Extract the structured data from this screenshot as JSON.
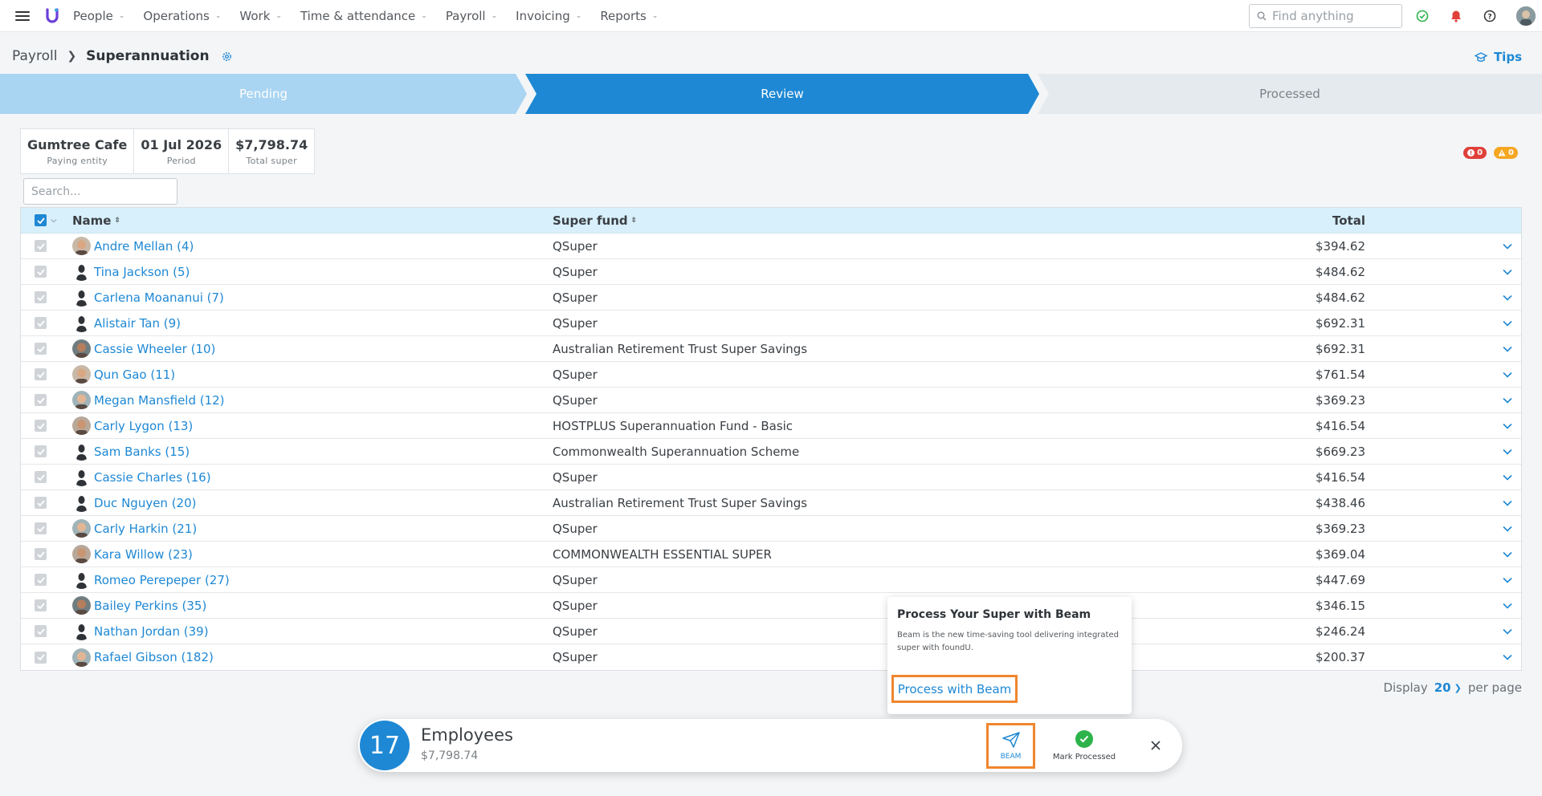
{
  "nav": {
    "items": [
      {
        "label": "People"
      },
      {
        "label": "Operations"
      },
      {
        "label": "Work"
      },
      {
        "label": "Time & attendance"
      },
      {
        "label": "Payroll"
      },
      {
        "label": "Invoicing"
      },
      {
        "label": "Reports"
      }
    ],
    "search_placeholder": "Find anything"
  },
  "breadcrumb": {
    "parent": "Payroll",
    "current": "Superannuation"
  },
  "tips_label": "Tips",
  "stepper": {
    "steps": [
      "Pending",
      "Review",
      "Processed"
    ],
    "active": "Review"
  },
  "summary": {
    "entity": "Gumtree Cafe",
    "entity_label": "Paying entity",
    "period": "01 Jul 2026",
    "period_label": "Period",
    "total": "$7,798.74",
    "total_label": "Total super"
  },
  "badges": {
    "errors": "0",
    "warnings": "0"
  },
  "table": {
    "search_placeholder": "Search...",
    "columns": {
      "name": "Name",
      "fund": "Super fund",
      "total": "Total"
    },
    "rows": [
      {
        "name": "Andre Mellan (4)",
        "fund": "QSuper",
        "total": "$394.62",
        "avatar": "photo"
      },
      {
        "name": "Tina Jackson (5)",
        "fund": "QSuper",
        "total": "$484.62",
        "avatar": "silhouette"
      },
      {
        "name": "Carlena Moananui (7)",
        "fund": "QSuper",
        "total": "$484.62",
        "avatar": "silhouette"
      },
      {
        "name": "Alistair Tan (9)",
        "fund": "QSuper",
        "total": "$692.31",
        "avatar": "silhouette"
      },
      {
        "name": "Cassie Wheeler (10)",
        "fund": "Australian Retirement Trust Super Savings",
        "total": "$692.31",
        "avatar": "photo"
      },
      {
        "name": "Qun Gao (11)",
        "fund": "QSuper",
        "total": "$761.54",
        "avatar": "photo"
      },
      {
        "name": "Megan Mansfield (12)",
        "fund": "QSuper",
        "total": "$369.23",
        "avatar": "photo"
      },
      {
        "name": "Carly Lygon (13)",
        "fund": "HOSTPLUS Superannuation Fund - Basic",
        "total": "$416.54",
        "avatar": "photo"
      },
      {
        "name": "Sam Banks (15)",
        "fund": "Commonwealth Superannuation Scheme",
        "total": "$669.23",
        "avatar": "silhouette"
      },
      {
        "name": "Cassie Charles (16)",
        "fund": "QSuper",
        "total": "$416.54",
        "avatar": "silhouette"
      },
      {
        "name": "Duc Nguyen (20)",
        "fund": "Australian Retirement Trust Super Savings",
        "total": "$438.46",
        "avatar": "silhouette"
      },
      {
        "name": "Carly Harkin (21)",
        "fund": "QSuper",
        "total": "$369.23",
        "avatar": "photo"
      },
      {
        "name": "Kara Willow (23)",
        "fund": "COMMONWEALTH ESSENTIAL SUPER",
        "total": "$369.04",
        "avatar": "photo"
      },
      {
        "name": "Romeo Perepeper (27)",
        "fund": "QSuper",
        "total": "$447.69",
        "avatar": "silhouette"
      },
      {
        "name": "Bailey Perkins (35)",
        "fund": "QSuper",
        "total": "$346.15",
        "avatar": "photo"
      },
      {
        "name": "Nathan Jordan (39)",
        "fund": "QSuper",
        "total": "$246.24",
        "avatar": "silhouette"
      },
      {
        "name": "Rafael Gibson (182)",
        "fund": "QSuper",
        "total": "$200.37",
        "avatar": "photo"
      }
    ]
  },
  "pagination": {
    "prefix": "Display",
    "per_page": "20",
    "suffix": "per page"
  },
  "popover": {
    "title": "Process Your Super with Beam",
    "body": "Beam is the new time-saving tool delivering integrated super with foundU.",
    "button": "Process with Beam"
  },
  "bottom_bar": {
    "count": "17",
    "title": "Employees",
    "amount": "$7,798.74",
    "beam_label": "BEAM",
    "mark_label": "Mark Processed"
  },
  "colors": {
    "accent": "#1e88d4",
    "highlight": "#f0862e",
    "success": "#2db34a",
    "error": "#e0403a",
    "warning": "#f5a623"
  }
}
